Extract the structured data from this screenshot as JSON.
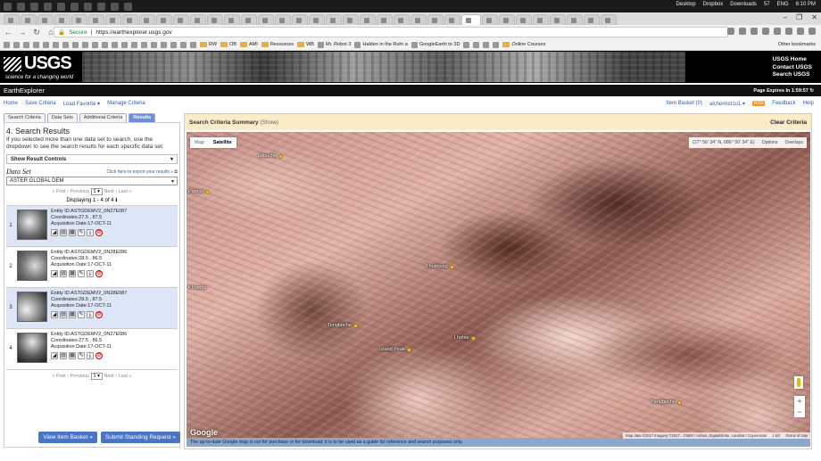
{
  "os": {
    "tray": [
      "Desktop",
      "Dropbox",
      "Downloads",
      "57",
      "ENG",
      "6:10 PM"
    ]
  },
  "browser": {
    "secure_label": "Secure",
    "url": "https://earthexplorer.usgs.gov",
    "window_controls": [
      "–",
      "❐",
      "✕"
    ],
    "bookmarks": [
      "RW",
      "OB",
      "AMI",
      "Resources",
      "WB",
      "Mr. Robot 3",
      "Halden in the Ruhr a",
      "GoogleEarth to 3D",
      "Online Courses"
    ],
    "other_bookmarks": "Other bookmarks"
  },
  "usgs": {
    "logo": "USGS",
    "tagline": "science for a changing world",
    "links": [
      "USGS Home",
      "Contact USGS",
      "Search USGS"
    ]
  },
  "app": {
    "title": "EarthExplorer",
    "page_expires": "Page Expires In 1:59:57",
    "menu": [
      "Home",
      "Save Criteria",
      "Load Favorite ▾",
      "Manage Criteria"
    ],
    "item_basket": "Item Basket (0)",
    "user": "alchemist1o1 ▾",
    "rss": "RSS",
    "feedback": "Feedback",
    "help": "Help"
  },
  "left": {
    "tabs": [
      "Search Criteria",
      "Data Sets",
      "Additional Criteria",
      "Results"
    ],
    "heading": "4. Search Results",
    "info": "If you selected more than one data set to search, use the dropdown to see the search results for each specific data set.",
    "result_controls": "Show Result Controls",
    "dataset_label": "Data Set",
    "export_link": "Click here to export your results »",
    "dataset_value": "ASTER GLOBAL DEM",
    "pager_prev": "« First ‹ Previous",
    "pager_page": "1",
    "pager_next": "Next › Last »",
    "displaying": "Displaying 1 - 4 of 4",
    "results": [
      {
        "num": "1",
        "entity": "Entity ID:ASTGDEMV2_0N27E087",
        "coords": "Coordinates:27.5 , 87.5",
        "date": "Acquisition Date:17-OCT-11"
      },
      {
        "num": "2",
        "entity": "Entity ID:ASTGDEMV2_0N28E086",
        "coords": "Coordinates:28.5 , 86.5",
        "date": "Acquisition Date:17-OCT-11"
      },
      {
        "num": "3",
        "entity": "Entity ID:ASTGDEMV2_0N28E087",
        "coords": "Coordinates:28.5 , 87.5",
        "date": "Acquisition Date:17-OCT-11"
      },
      {
        "num": "4",
        "entity": "Entity ID:ASTGDEMV2_0N27E086",
        "coords": "Coordinates:27.5 , 86.5",
        "date": "Acquisition Date:17-OCT-11"
      }
    ],
    "view_basket": "View Item Basket »",
    "submit_standing": "Submit Standing Request »"
  },
  "right": {
    "summary_title": "Search Criteria Summary",
    "summary_show": "(Show)",
    "clear": "Clear Criteria",
    "map_type": [
      "Map",
      "Satellite"
    ],
    "coords": "(27° 56' 34\" N, 086° 50' 34\" E)",
    "options": "Options",
    "overlays": "Overlays",
    "places": [
      "Lobuche",
      "Pumori",
      "Khumjung",
      "Tengboche",
      "Lhotse",
      "Island Peak",
      "Khumbu",
      "Pangboche"
    ],
    "google": "Google",
    "attribution": [
      "Map data ©2017 Imagery ©2017 , CNES / Airbus, DigitalGlobe, Landsat / Copernicus",
      "1 km",
      "Terms of Use"
    ],
    "disclaimer": "The up-to-date Google map is not for purchase or for download; it is to be used as a guide for reference and search purposes only."
  }
}
